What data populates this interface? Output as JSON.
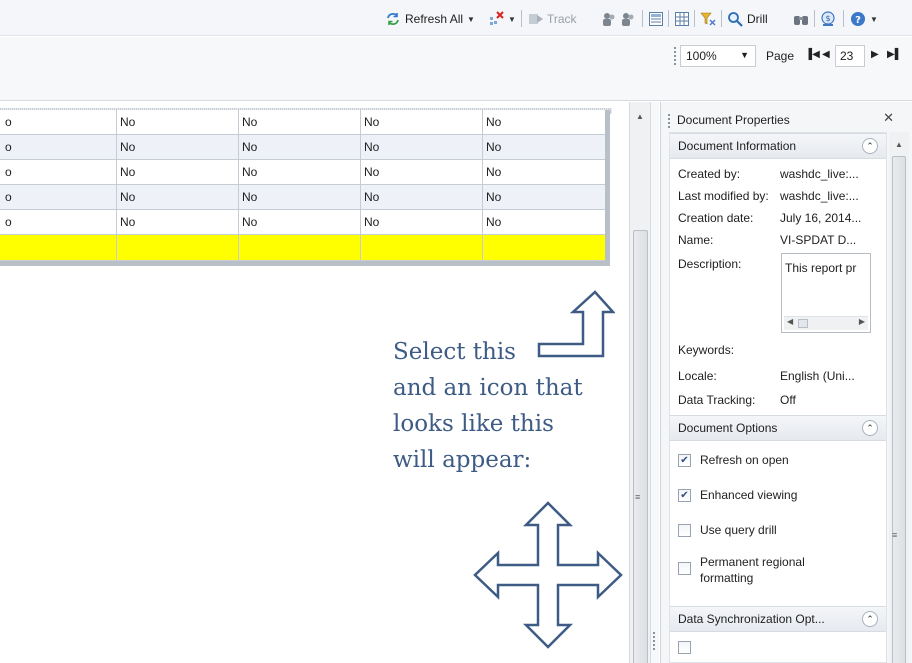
{
  "toolbar": {
    "refresh_all": "Refresh All",
    "track": "Track",
    "drill": "Drill"
  },
  "viewbar": {
    "zoom": "100%",
    "page_label": "Page",
    "page_number": "23"
  },
  "report": {
    "rows": [
      [
        "o",
        "No",
        "No",
        "No",
        "No"
      ],
      [
        "o",
        "No",
        "No",
        "No",
        "No"
      ],
      [
        "o",
        "No",
        "No",
        "No",
        "No"
      ],
      [
        "o",
        "No",
        "No",
        "No",
        "No"
      ],
      [
        "o",
        "No",
        "No",
        "No",
        "No"
      ],
      [
        "",
        "",
        "",
        "",
        ""
      ]
    ]
  },
  "instruction": {
    "line1": "Select this",
    "line2": "and an icon that",
    "line3": "looks like this",
    "line4": "will appear:"
  },
  "panel": {
    "title": "Document Properties",
    "doc_info": {
      "title": "Document Information",
      "created_by_label": "Created by:",
      "created_by": "washdc_live:...",
      "last_modified_label": "Last modified by:",
      "last_modified": "washdc_live:...",
      "creation_date_label": "Creation date:",
      "creation_date": "July 16, 2014...",
      "name_label": "Name:",
      "name": "VI-SPDAT D...",
      "description_label": "Description:",
      "description": "This report pr",
      "keywords_label": "Keywords:",
      "locale_label": "Locale:",
      "locale": "English (Uni...",
      "data_tracking_label": "Data Tracking:",
      "data_tracking": "Off"
    },
    "doc_options": {
      "title": "Document Options",
      "refresh_on_open": "Refresh on open",
      "enhanced_viewing": "Enhanced viewing",
      "use_query_drill": "Use query drill",
      "permanent_regional_1": "Permanent regional",
      "permanent_regional_2": "formatting"
    },
    "data_sync": {
      "title": "Data Synchronization Opt..."
    }
  },
  "colors": {
    "instruction_text": "#3d5b85",
    "highlight_row": "#ffff00",
    "alt_row": "#eef1f8"
  }
}
